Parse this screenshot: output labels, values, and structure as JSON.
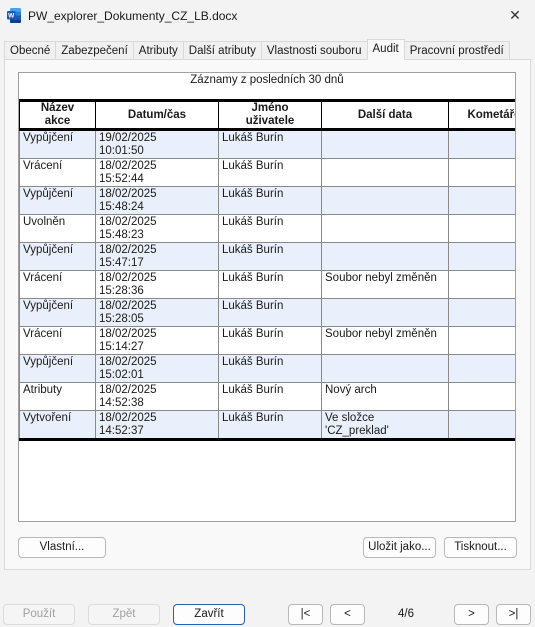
{
  "window": {
    "title": "PW_explorer_Dokumenty_CZ_LB.docx",
    "close_glyph": "✕",
    "app_icon": "word-icon"
  },
  "tabs": [
    "Obecné",
    "Zabezpečení",
    "Atributy",
    "Další atributy",
    "Vlastnosti souboru",
    "Audit",
    "Pracovní prostředí"
  ],
  "active_tab": "Audit",
  "table": {
    "caption": "Záznamy z posledních 30 dnů",
    "headers": {
      "action_line1": "Název",
      "action_line2": "akce",
      "datetime": "Datum/čas",
      "user_line1": "Jméno",
      "user_line2": "uživatele",
      "extra": "Další data",
      "comments": "Kometáře"
    },
    "rows": [
      {
        "action": "Vypůjčení",
        "date": "19/02/2025",
        "time": "10:01:50",
        "user": "Lukáš Burín",
        "extra1": "",
        "extra2": "",
        "comment": ""
      },
      {
        "action": "Vrácení",
        "date": "18/02/2025",
        "time": "15:52:44",
        "user": "Lukáš Burín",
        "extra1": "",
        "extra2": "",
        "comment": ""
      },
      {
        "action": "Vypůjčení",
        "date": "18/02/2025",
        "time": "15:48:24",
        "user": "Lukáš Burín",
        "extra1": "",
        "extra2": "",
        "comment": ""
      },
      {
        "action": "Uvolněn",
        "date": "18/02/2025",
        "time": "15:48:23",
        "user": "Lukáš Burín",
        "extra1": "",
        "extra2": "",
        "comment": ""
      },
      {
        "action": "Vypůjčení",
        "date": "18/02/2025",
        "time": "15:47:17",
        "user": "Lukáš Burín",
        "extra1": "",
        "extra2": "",
        "comment": ""
      },
      {
        "action": "Vrácení",
        "date": "18/02/2025",
        "time": "15:28:36",
        "user": "Lukáš Burín",
        "extra1": "Soubor nebyl změněn",
        "extra2": "",
        "comment": ""
      },
      {
        "action": "Vypůjčení",
        "date": "18/02/2025",
        "time": "15:28:05",
        "user": "Lukáš Burín",
        "extra1": "",
        "extra2": "",
        "comment": ""
      },
      {
        "action": "Vrácení",
        "date": "18/02/2025",
        "time": "15:14:27",
        "user": "Lukáš Burín",
        "extra1": "Soubor nebyl změněn",
        "extra2": "",
        "comment": ""
      },
      {
        "action": "Vypůjčení",
        "date": "18/02/2025",
        "time": "15:02:01",
        "user": "Lukáš Burín",
        "extra1": "",
        "extra2": "",
        "comment": ""
      },
      {
        "action": "Atributy",
        "date": "18/02/2025",
        "time": "14:52:38",
        "user": "Lukáš Burín",
        "extra1": "Nový arch",
        "extra2": "",
        "comment": ""
      },
      {
        "action": "Vytvoření",
        "date": "18/02/2025",
        "time": "14:52:37",
        "user": "Lukáš Burín",
        "extra1": "Ve složce",
        "extra2": "'CZ_preklad'",
        "comment": ""
      }
    ]
  },
  "buttons": {
    "custom": "Vlastní...",
    "save_as": "Uložit jako...",
    "print": "Tisknout...",
    "apply": "Použít",
    "back": "Zpět",
    "close": "Zavřít",
    "first": "|<",
    "prev": "<",
    "next": ">",
    "last": ">|"
  },
  "pagination": {
    "current": "4/6"
  },
  "colors": {
    "row_alt": "#eaf0fb",
    "accent": "#2a5fb8"
  }
}
